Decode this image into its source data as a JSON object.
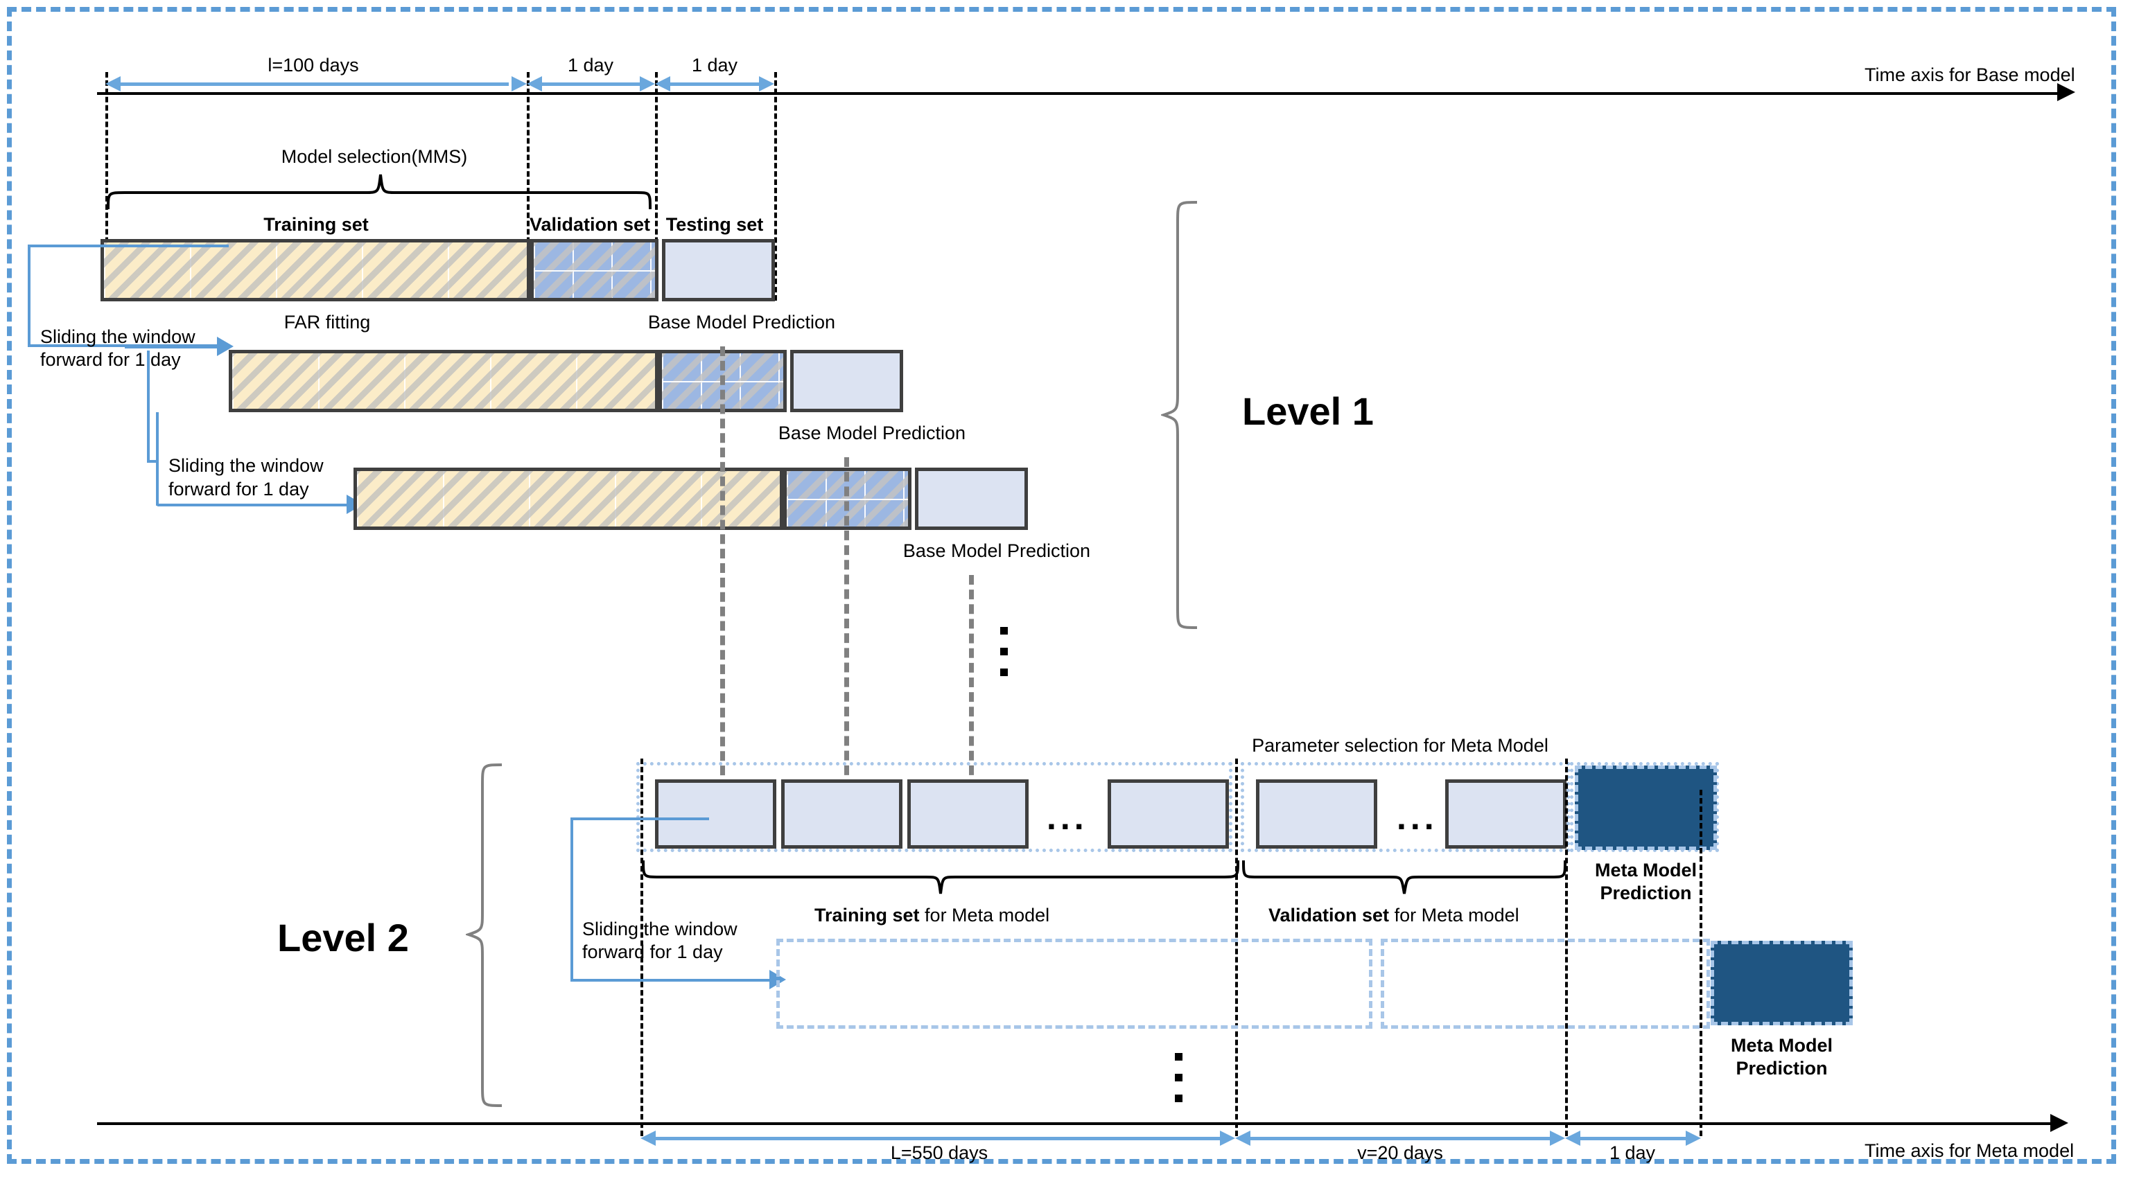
{
  "diagram": {
    "title_level1": "Level 1",
    "title_level2": "Level 2"
  },
  "axes": {
    "base": {
      "label": "Time axis  for Base model"
    },
    "meta": {
      "label": "Time axis  for Meta model"
    }
  },
  "base_measures": {
    "window": "l=100 days",
    "validation": "1 day",
    "testing": "1 day"
  },
  "meta_measures": {
    "training": "L=550 days",
    "validation": "v=20 days",
    "prediction": "1 day"
  },
  "level1": {
    "model_selection_label": "Model selection(MMS)",
    "set_labels": {
      "training": "Training set",
      "validation": "Validation set",
      "testing": "Testing set"
    },
    "far_fitting": "FAR fitting",
    "prediction_label": "Base Model Prediction",
    "slide_note": "Sliding the window\nforward for 1 day",
    "slide_note_line1": "Sliding the window",
    "slide_note_line2": "forward for 1 day",
    "rows": [
      {
        "prediction": "Base Model Prediction"
      },
      {
        "prediction": "Base Model Prediction"
      },
      {
        "prediction": "Base Model Prediction"
      }
    ]
  },
  "level2": {
    "parameter_selection_label": "Parameter selection for Meta Model",
    "training_brace_bold": "Training set",
    "training_brace_rest": " for Meta model",
    "validation_brace_bold": "Validation set",
    "validation_brace_rest": " for Meta model",
    "slide_note_line1": "Sliding the window",
    "slide_note_line2": "forward for 1 day",
    "meta_prediction_label_line1": "Meta Model",
    "meta_prediction_label_line2": "Prediction",
    "ellipsis": "..."
  },
  "colors": {
    "frame_blue": "#5b9bd5",
    "training_fill": "#fbecc8",
    "validation_fill": "#9cb7e2",
    "testing_fill": "#dce3f2",
    "meta_prediction_fill": "#1f5582",
    "block_border": "#3f3f3f",
    "connector_gray": "#808080"
  }
}
